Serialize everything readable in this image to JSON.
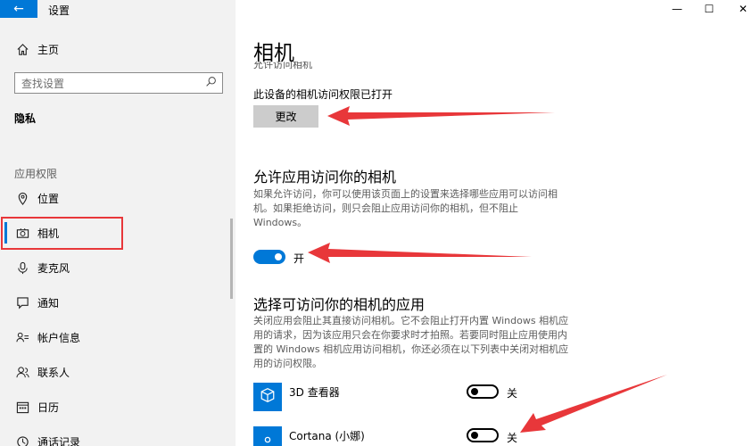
{
  "window": {
    "title": "设置",
    "minimize_glyph": "—",
    "maximize_glyph": "☐",
    "close_glyph": "✕"
  },
  "sidebar": {
    "home_label": "主页",
    "search_placeholder": "查找设置",
    "privacy_label": "隐私",
    "app_permissions_label": "应用权限",
    "items": [
      {
        "label": "位置",
        "icon": "location-icon"
      },
      {
        "label": "相机",
        "icon": "camera-icon",
        "selected": true
      },
      {
        "label": "麦克风",
        "icon": "microphone-icon"
      },
      {
        "label": "通知",
        "icon": "notification-icon"
      },
      {
        "label": "帐户信息",
        "icon": "account-info-icon"
      },
      {
        "label": "联系人",
        "icon": "contacts-icon"
      },
      {
        "label": "日历",
        "icon": "calendar-icon"
      },
      {
        "label": "通话记录",
        "icon": "call-history-icon"
      }
    ]
  },
  "main": {
    "page_title": "相机",
    "cut_text": "允许访问相机",
    "device_status": "此设备的相机访问权限已打开",
    "change_button": "更改",
    "allow_heading": "允许应用访问你的相机",
    "allow_desc": "如果允许访问，你可以使用该页面上的设置来选择哪些应用可以访问相机。如果拒绝访问，则只会阻止应用访问你的相机，但不阻止 Windows。",
    "allow_toggle_label": "开",
    "choose_heading": "选择可访问你的相机的应用",
    "choose_desc": "关闭应用会阻止其直接访问相机。它不会阻止打开内置 Windows 相机应用的请求，因为该应用只会在你要求时才拍照。若要同时阻止应用使用内置的 Windows 相机应用访问相机，你还必须在以下列表中关闭对相机应用的访问权限。",
    "apps": [
      {
        "name": "3D 查看器",
        "state_label": "关",
        "on": false,
        "icon": "cube-icon"
      },
      {
        "name": "Cortana (小娜)",
        "state_label": "关",
        "on": false,
        "icon": "cortana-icon"
      }
    ]
  },
  "colors": {
    "accent": "#0078d7",
    "annotation_red": "#e8373a",
    "sidebar_bg": "#f2f2f2"
  }
}
